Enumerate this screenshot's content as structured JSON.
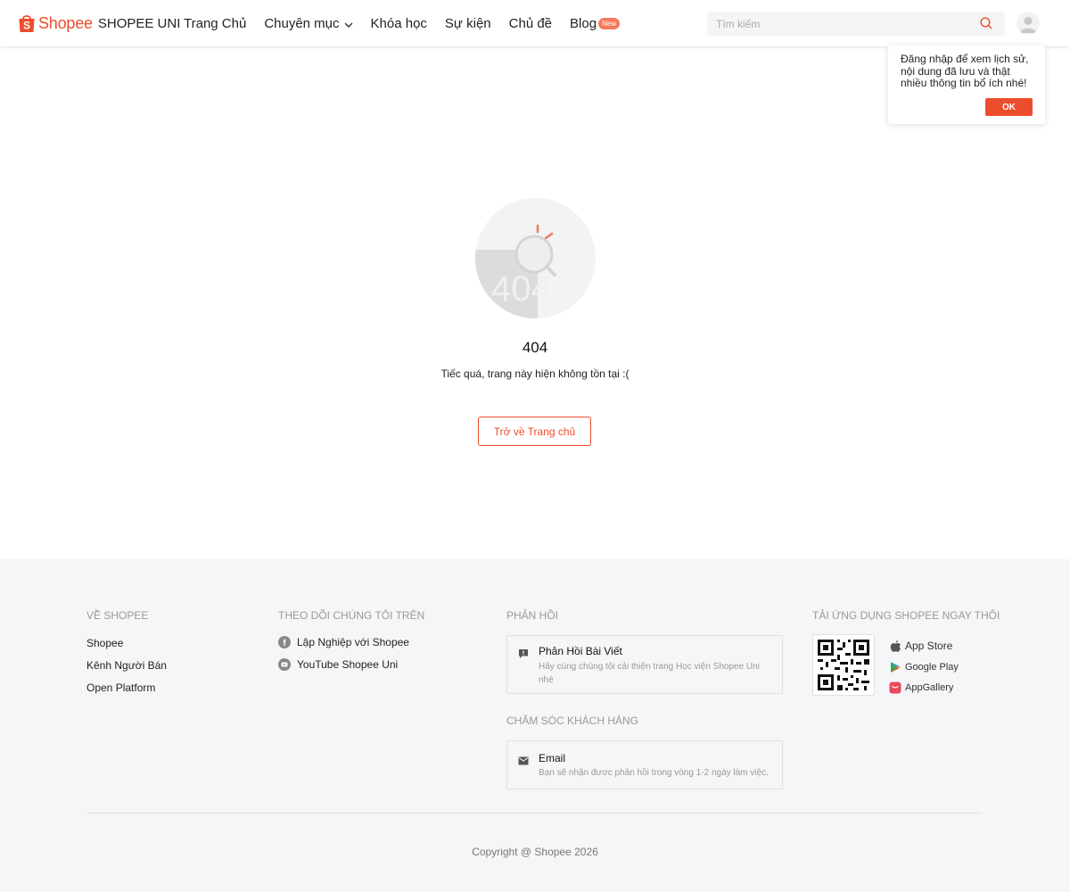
{
  "header": {
    "logo_word": "Shopee",
    "logo_sub": "SHOPEE UNI",
    "nav": [
      {
        "label": "Trang Chủ"
      },
      {
        "label": "Chuyên mục"
      },
      {
        "label": "Khóa học"
      },
      {
        "label": "Sự kiện"
      },
      {
        "label": "Chủ đề"
      },
      {
        "label": "Blog"
      }
    ],
    "new_badge": "New",
    "search_placeholder": "Tìm kiếm"
  },
  "popover": {
    "text": "Đăng nhập để xem lịch sử, nội dung đã lưu và thật nhiều thông tin bổ ích nhé!",
    "ok_label": "OK"
  },
  "error": {
    "code": "404",
    "message": "Tiếc quá, trang này hiện không tồn tại :(",
    "home_button": "Trở về Trang chủ",
    "illustration_text": "404"
  },
  "footer": {
    "about_heading": "VỀ SHOPEE",
    "about_links": [
      "Shopee",
      "Kênh Người Bán",
      "Open Platform"
    ],
    "follow_heading": "THEO DÕI CHÚNG TÔI TRÊN",
    "follow_links": [
      "Lập Nghiệp với Shopee",
      "YouTube Shopee Uni"
    ],
    "feedback_heading": "PHẢN HỒI",
    "feedback_card": {
      "title": "Phản Hồi Bài Viết",
      "desc": "Hãy cùng chúng tôi cải thiện trang Học viện Shopee Uni nhé"
    },
    "care_heading": "CHĂM SÓC KHÁCH HÀNG",
    "care_card": {
      "title": "Email",
      "desc": "Bạn sẽ nhận được phản hồi trong vòng 1-2 ngày làm việc."
    },
    "app_heading": "TẢI ỨNG DỤNG SHOPEE NGAY THÔI",
    "stores": [
      "App Store",
      "Google Play",
      "AppGallery"
    ],
    "copyright": "Copyright @ Shopee 2026"
  },
  "colors": {
    "brand": "#ee4d2d"
  }
}
